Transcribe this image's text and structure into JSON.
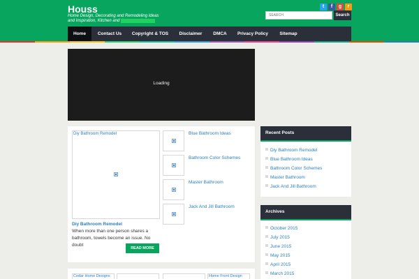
{
  "header": {
    "site_title": "Houss",
    "tagline": "Home Design, Decorating and Remodeling Ideas and Inspiration, Kitchen and",
    "tagline_highlight": "Bathroom Designs",
    "social": {
      "twitter": "t",
      "facebook": "f",
      "google": "g",
      "rss": "r"
    },
    "search_placeholder": "SEARCH",
    "search_label": "Search"
  },
  "nav": [
    {
      "label": "Home"
    },
    {
      "label": "Contact Us"
    },
    {
      "label": "Copyright & TOS"
    },
    {
      "label": "Disclaimer"
    },
    {
      "label": "DMCA"
    },
    {
      "label": "Privacy Policy"
    },
    {
      "label": "Sitemap"
    }
  ],
  "colors": {
    "header_green": "#08a55f",
    "nav_dark": "#2b2f3a",
    "link_blue": "#2a7fbf",
    "rainbow": [
      "#e6312e",
      "#f39c12",
      "#f1c40f",
      "#2ecc71",
      "#1abc9c",
      "#3498db",
      "#9b59b6",
      "#e84393",
      "#8e44ad",
      "#16a085",
      "#d35400",
      "#2980b9"
    ]
  },
  "video": {
    "status_text": "Loading"
  },
  "featured": {
    "thumb_label": "Diy Bathroom Remodel",
    "title": "Diy Bathroom Remodel",
    "excerpt": "When more than one person shares a bathroom, towels become an issue. No doubt",
    "read_more": "READ MORE",
    "related": [
      {
        "label": "Blue Bathroom Ideas"
      },
      {
        "label": "Bathroom Color Schemes"
      },
      {
        "label": "Master Bathroom"
      },
      {
        "label": "Jack And Jill Bathroom"
      }
    ]
  },
  "bottom_posts": [
    {
      "label": "Cedar Home Designs"
    },
    {
      "label": ""
    },
    {
      "label": ""
    },
    {
      "label": "Home Front Design"
    }
  ],
  "recent_posts": {
    "title": "Recent Posts",
    "items": [
      {
        "label": "Diy Bathroom Remodel"
      },
      {
        "label": "Blue Bathroom Ideas"
      },
      {
        "label": "Bathroom Color Schemes"
      },
      {
        "label": "Master Bathroom"
      },
      {
        "label": "Jack And Jill Bathroom"
      }
    ]
  },
  "archives": {
    "title": "Archives",
    "items": [
      {
        "label": "October 2015"
      },
      {
        "label": "July 2015"
      },
      {
        "label": "June 2015"
      },
      {
        "label": "May 2015"
      },
      {
        "label": "April 2015"
      },
      {
        "label": "March 2015"
      }
    ]
  }
}
